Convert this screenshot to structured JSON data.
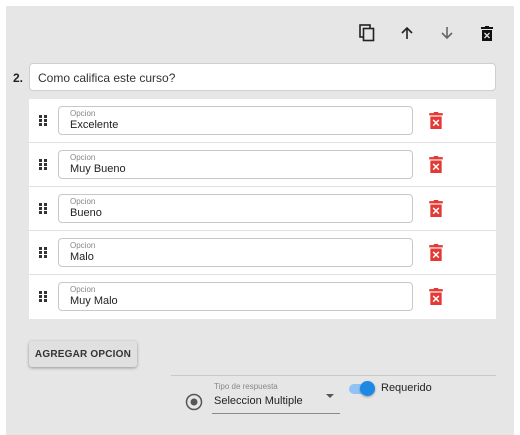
{
  "toolbar": {
    "icons": [
      "copy-icon",
      "arrow-up-icon",
      "arrow-down-icon",
      "delete-icon"
    ]
  },
  "question": {
    "number": "2.",
    "text": "Como califica este curso?"
  },
  "options": [
    {
      "label": "Opcion",
      "value": "Excelente"
    },
    {
      "label": "Opcion",
      "value": "Muy Bueno"
    },
    {
      "label": "Opcion",
      "value": "Bueno"
    },
    {
      "label": "Opcion",
      "value": "Malo"
    },
    {
      "label": "Opcion",
      "value": "Muy Malo"
    }
  ],
  "add_option_label": "AGREGAR OPCION",
  "answer_type": {
    "label": "Tipo de respuesta",
    "value": "Seleccion Multiple"
  },
  "required": {
    "label": "Requerido",
    "on": true
  },
  "colors": {
    "accent": "#1e88e5",
    "delete": "#e53935",
    "panel": "#e6e6e6"
  }
}
